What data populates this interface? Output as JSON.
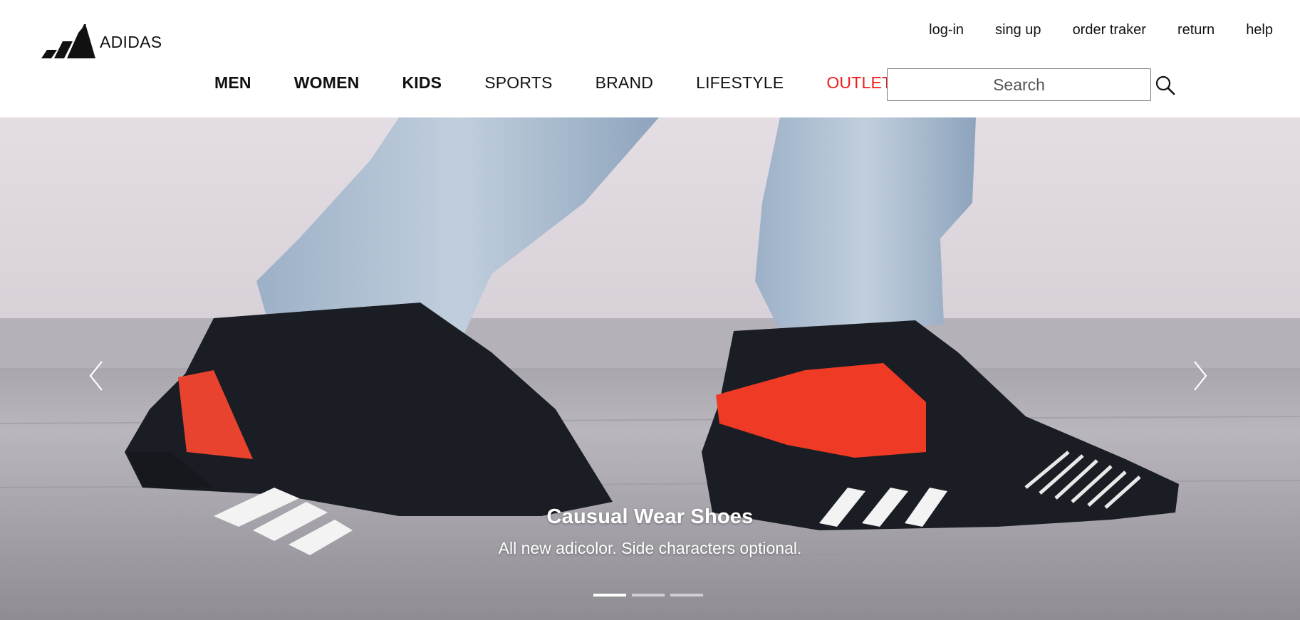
{
  "brand": {
    "name": "ADIDAS",
    "logo_icon": "adidas-performance-logo-icon"
  },
  "utility_nav": [
    {
      "label": "log-in"
    },
    {
      "label": "sing up"
    },
    {
      "label": "order traker"
    },
    {
      "label": "return"
    },
    {
      "label": "help"
    }
  ],
  "main_nav": [
    {
      "label": "MEN",
      "style": "bold"
    },
    {
      "label": "WOMEN",
      "style": "bold"
    },
    {
      "label": "KIDS",
      "style": "bold"
    },
    {
      "label": "SPORTS",
      "style": "regular"
    },
    {
      "label": "BRAND",
      "style": "regular"
    },
    {
      "label": "LIFESTYLE",
      "style": "regular"
    },
    {
      "label": "OUTLET",
      "style": "highlight"
    }
  ],
  "search": {
    "placeholder": "Search",
    "value": "",
    "icon": "search-icon"
  },
  "carousel": {
    "slides": [
      {
        "title": "Causual Wear Shoes",
        "text": "All new adicolor. Side characters optional.",
        "image": "sneakers-on-feet-photo"
      }
    ],
    "active_index": 0,
    "indicator_count": 3,
    "prev_icon": "chevron-left-icon",
    "next_icon": "chevron-right-icon"
  },
  "colors": {
    "outlet": "#ee1c1c",
    "header_bg": "#ffffff",
    "text": "#111111"
  }
}
